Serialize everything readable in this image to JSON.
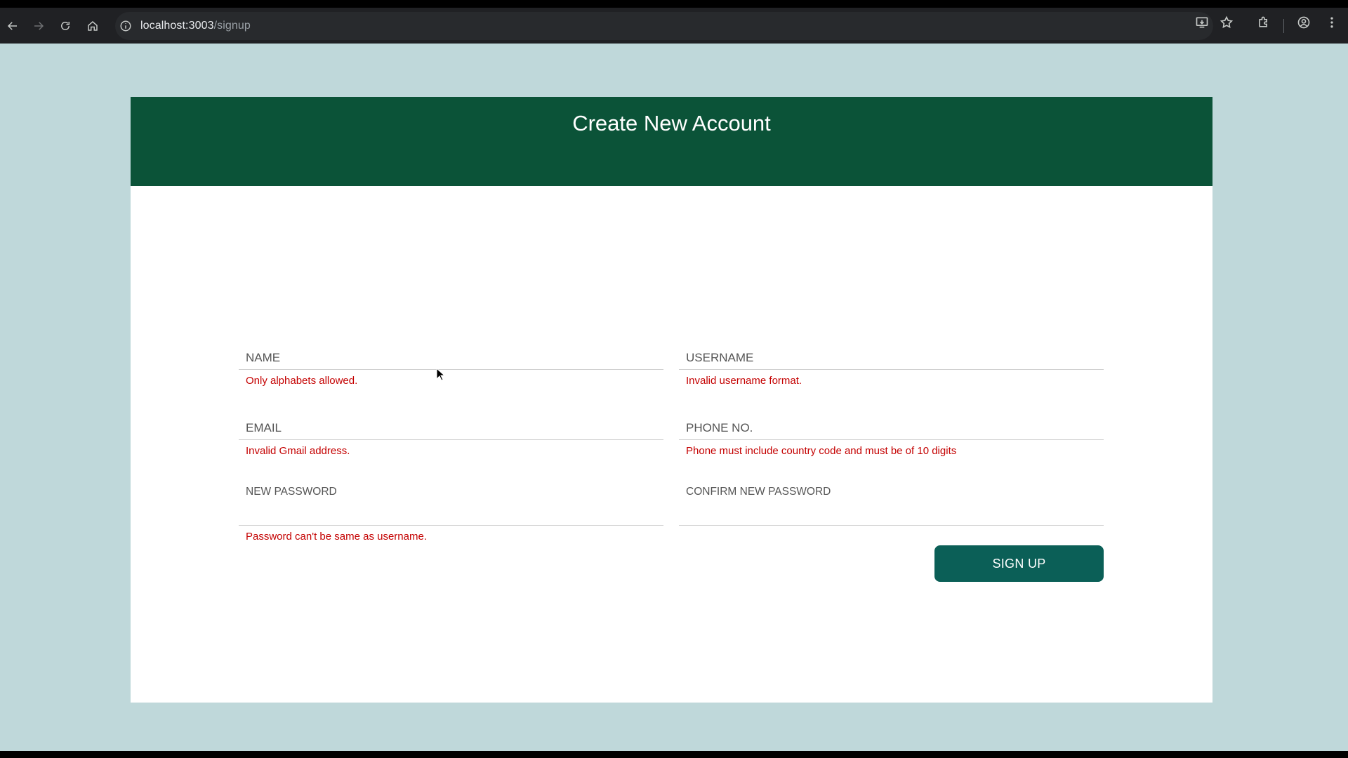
{
  "browser": {
    "url_host": "localhost:3003",
    "url_path": "/signup"
  },
  "page": {
    "title": "Create New Account",
    "fields": {
      "name": {
        "label": "NAME",
        "value": "",
        "error": "Only alphabets allowed."
      },
      "username": {
        "label": "USERNAME",
        "value": "",
        "error": "Invalid username format."
      },
      "email": {
        "label": "EMAIL",
        "value": "",
        "error": "Invalid Gmail address."
      },
      "phone": {
        "label": "PHONE NO.",
        "value": "",
        "error": "Phone must include country code and must be of 10 digits"
      },
      "new_password": {
        "label": "NEW PASSWORD",
        "value": "",
        "error": "Password can't be same as username."
      },
      "confirm_password": {
        "label": "CONFIRM NEW PASSWORD",
        "value": "",
        "error": ""
      }
    },
    "submit_label": "SIGN UP"
  },
  "colors": {
    "page_background": "#bfd8da",
    "header_background": "#0b5338",
    "button_background": "#0b5f57",
    "error_text": "#c40000"
  }
}
